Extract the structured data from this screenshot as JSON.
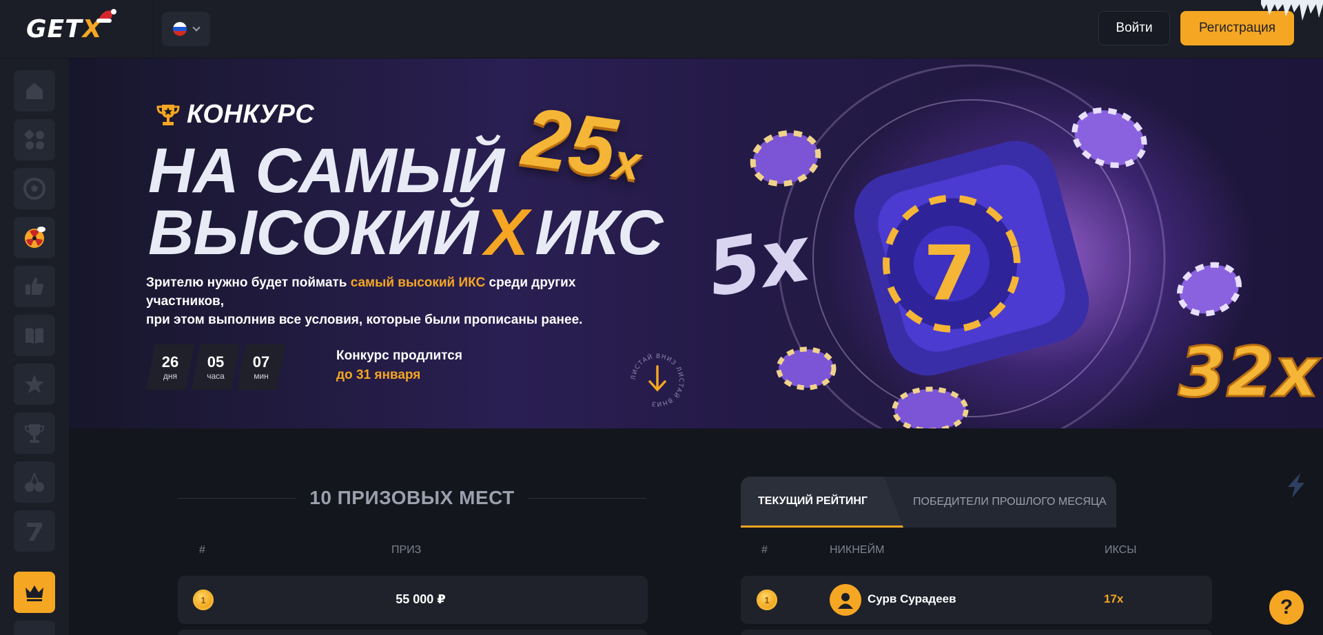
{
  "header": {
    "logo_text_main": "GET",
    "logo_text_x": "X",
    "login_label": "Войти",
    "register_label": "Регистрация"
  },
  "sidebar": {
    "items": [
      {
        "name": "home-icon"
      },
      {
        "name": "grid-icon"
      },
      {
        "name": "soccer-ball-icon"
      },
      {
        "name": "radiation-icon"
      },
      {
        "name": "thumbs-up-icon"
      },
      {
        "name": "book-icon"
      },
      {
        "name": "star-icon"
      },
      {
        "name": "trophy-icon"
      },
      {
        "name": "cherry-icon"
      },
      {
        "name": "seven-icon"
      },
      {
        "name": "crown-icon",
        "active": true
      }
    ]
  },
  "banner": {
    "tag": "КОНКУРС",
    "headline_line1": "НА САМЫЙ",
    "headline_line2_a": "ВЫСОКИЙ",
    "headline_line2_x": "X",
    "headline_line2_b": "ИКС",
    "badge_25": "25",
    "badge_x": "x",
    "desc_part1": "Зрителю нужно будет поймать ",
    "desc_highlight": "самый высокий ИКС",
    "desc_part2": " среди других участников,",
    "desc_line2": "при этом выполнив все условия, которые были прописаны ранее.",
    "timer": [
      {
        "value": "26",
        "label": "дня"
      },
      {
        "value": "05",
        "label": "часа"
      },
      {
        "value": "07",
        "label": "мин"
      }
    ],
    "lasts_text": "Конкурс продлится",
    "lasts_date": "до 31 января",
    "scroll_text": "ЛИСТАЙ ВНИЗ  ЛИСТАЙ ВНИЗ  ",
    "art_labels": [
      "5x",
      "7",
      "32x"
    ]
  },
  "prizes": {
    "title": "10 ПРИЗОВЫХ МЕСТ",
    "col_num": "#",
    "col_prize": "ПРИЗ",
    "rows": [
      {
        "place": "1",
        "prize": "55 000 ₽"
      }
    ]
  },
  "rating": {
    "tab_current": "ТЕКУЩИЙ РЕЙТИНГ",
    "tab_past": "ПОБЕДИТЕЛИ ПРОШЛОГО МЕСЯЦА",
    "col_num": "#",
    "col_nick": "НИКНЕЙМ",
    "col_x": "ИКСЫ",
    "rows": [
      {
        "place": "1",
        "nick": "Сурв Сурадеев",
        "x": "17x"
      }
    ]
  },
  "help_label": "?",
  "colors": {
    "accent": "#f5a623",
    "bg": "#14161d",
    "panel": "#1b1e27"
  }
}
